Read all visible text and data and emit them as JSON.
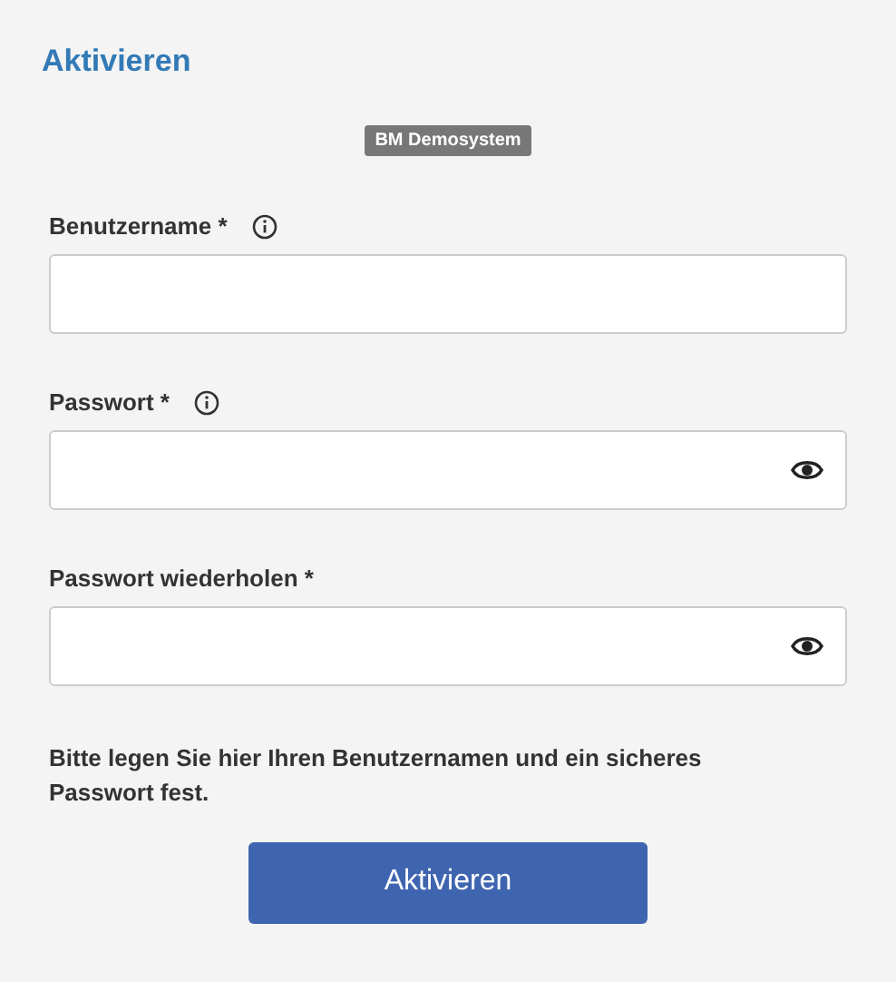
{
  "title": "Aktivieren",
  "badge": "BM Demosystem",
  "fields": [
    {
      "label": "Benutzername *",
      "info": true,
      "reveal": false
    },
    {
      "label": "Passwort *",
      "info": true,
      "reveal": true
    },
    {
      "label": "Passwort wiederholen *",
      "info": false,
      "reveal": true
    }
  ],
  "hint": "Bitte legen Sie hier Ihren Benutzernamen und ein sicheres Passwort fest.",
  "button": "Aktivieren"
}
